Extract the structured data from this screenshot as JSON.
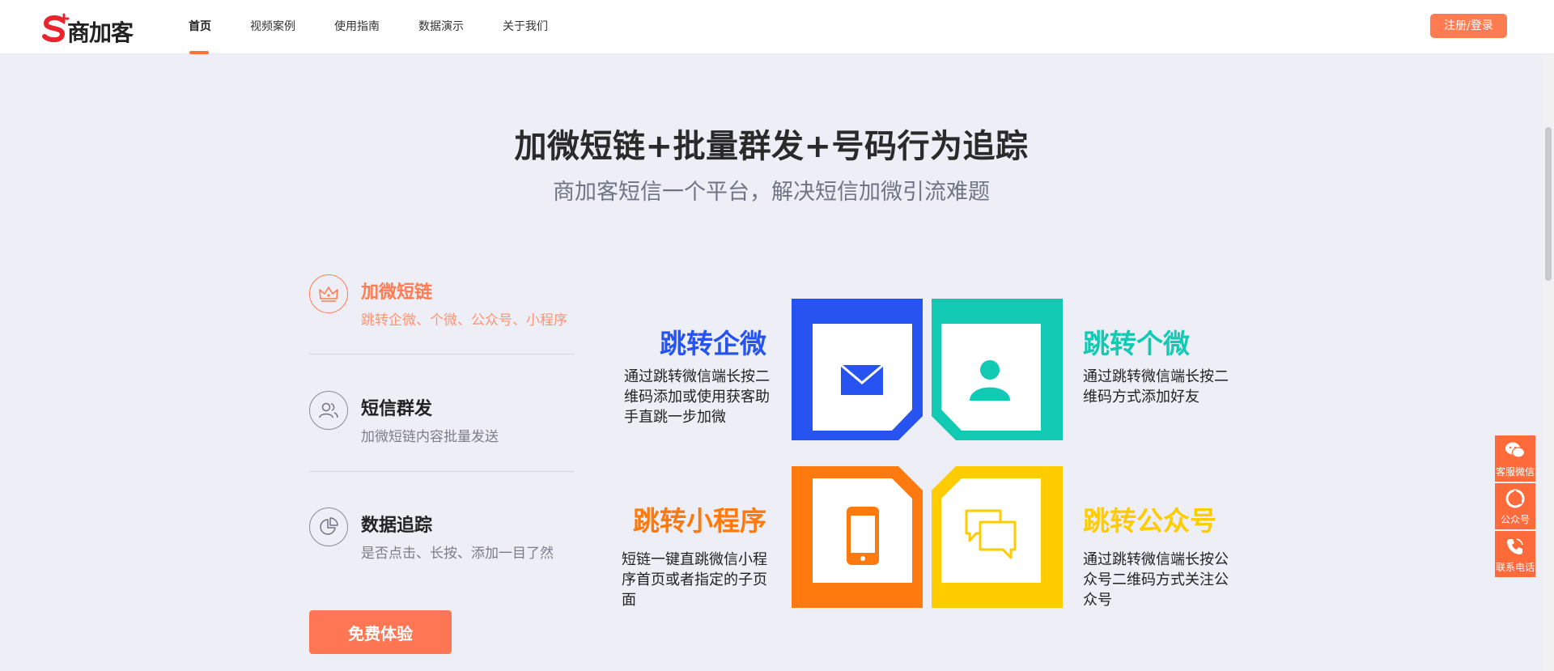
{
  "header": {
    "logo_text": "商加客",
    "nav": [
      {
        "label": "首页"
      },
      {
        "label": "视频案例"
      },
      {
        "label": "使用指南"
      },
      {
        "label": "数据演示"
      },
      {
        "label": "关于我们"
      }
    ],
    "login_label": "注册/登录"
  },
  "hero": {
    "title": "加微短链+批量群发+号码行为追踪",
    "subtitle": "商加客短信一个平台，解决短信加微引流难题"
  },
  "features": [
    {
      "title": "加微短链",
      "desc": "跳转企微、个微、公众号、小程序",
      "icon": "crown-icon"
    },
    {
      "title": "短信群发",
      "desc": "加微短链内容批量发送",
      "icon": "users-icon"
    },
    {
      "title": "数据追踪",
      "desc": "是否点击、长按、添加一目了然",
      "icon": "pie-chart-icon"
    }
  ],
  "cta_label": "免费体验",
  "tiles": {
    "qiwei": {
      "label": "跳转企微",
      "text": "通过跳转微信端长按二维码添加或使用获客助手直跳一步加微",
      "color": "#2754f0",
      "icon": "envelope-icon"
    },
    "gewei": {
      "label": "跳转个微",
      "text": "通过跳转微信端长按二维码方式添加好友",
      "color": "#12c9b4",
      "icon": "person-icon"
    },
    "xiaochengxu": {
      "label": "跳转小程序",
      "text": "短链一键直跳微信小程序首页或者指定的子页面",
      "color": "#ff7a0e",
      "icon": "phone-icon"
    },
    "gongzhonghao": {
      "label": "跳转公众号",
      "text": "通过跳转微信端长按公众号二维码方式关注公众号",
      "color": "#ffcc00",
      "icon": "chat-bubbles-icon"
    }
  },
  "side_float": [
    {
      "label": "客服微信",
      "icon": "wechat-icon"
    },
    {
      "label": "公众号",
      "icon": "official-account-icon"
    },
    {
      "label": "联系电话",
      "icon": "phone-call-icon"
    }
  ],
  "colors": {
    "accent": "#ff7c53",
    "background": "#eeeff6"
  }
}
